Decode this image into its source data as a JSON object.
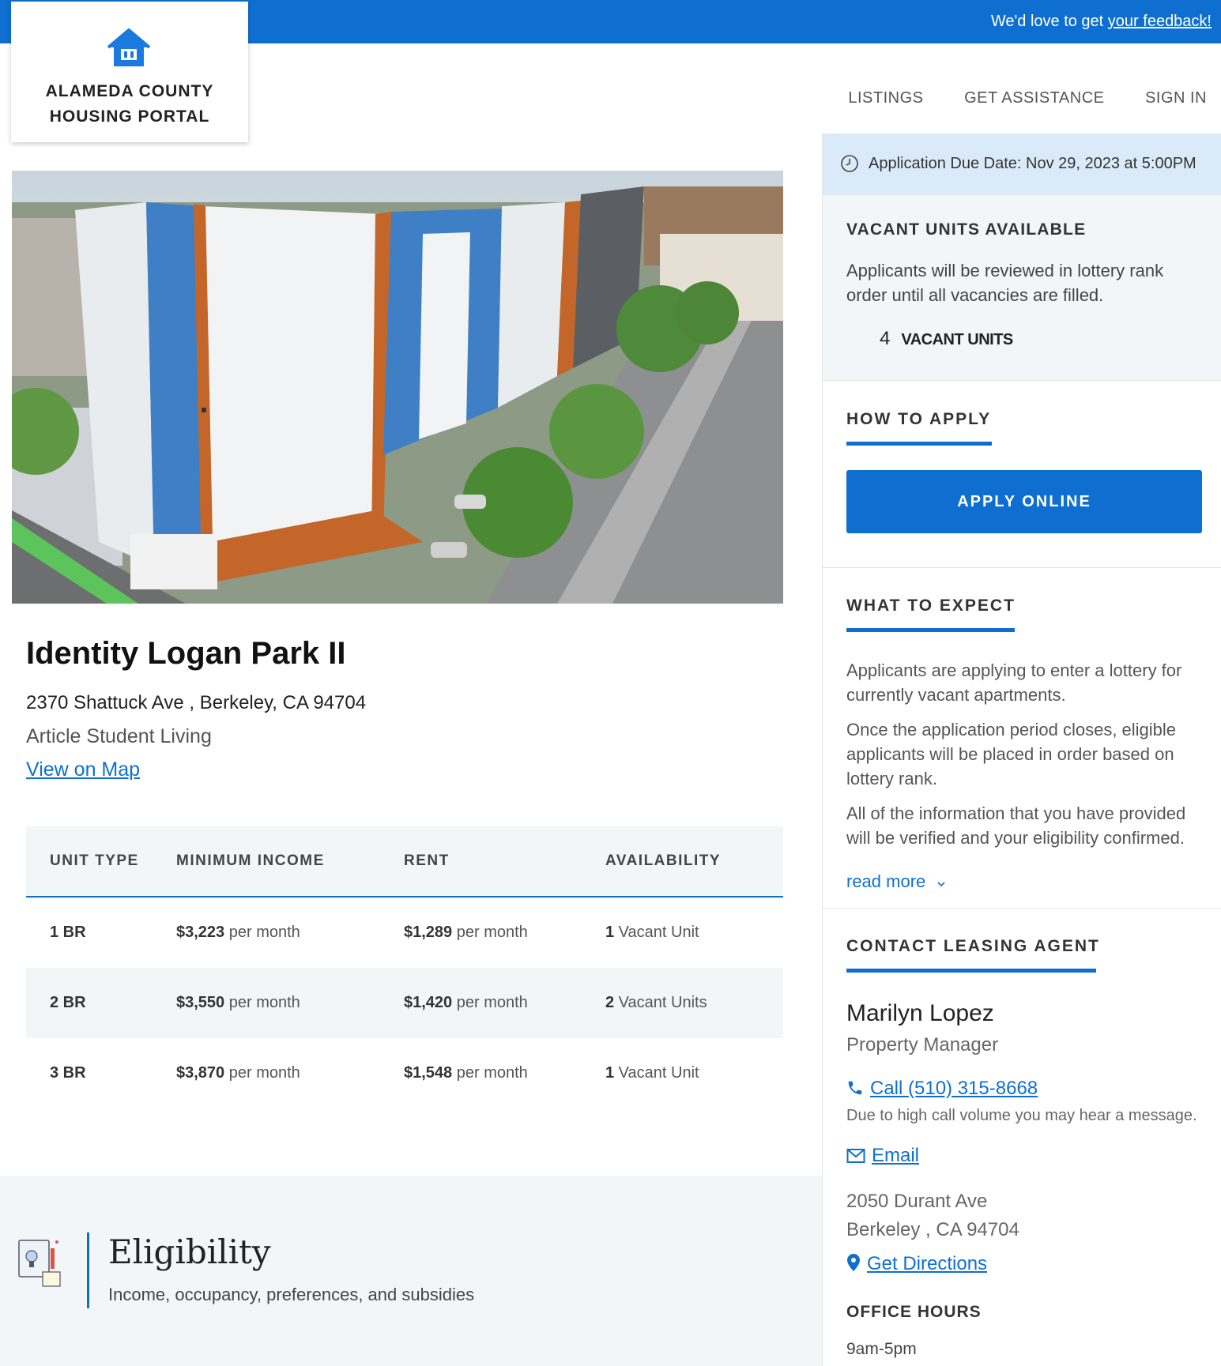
{
  "banner": {
    "feedback_prefix": "We'd love to get ",
    "feedback_link": "your feedback!"
  },
  "logo": {
    "line1": "ALAMEDA COUNTY",
    "line2": "HOUSING PORTAL",
    "icon": "house-icon"
  },
  "nav": {
    "items": [
      "LISTINGS",
      "GET ASSISTANCE",
      "SIGN IN"
    ]
  },
  "listing": {
    "photo_alt": "aerial photo of apartment building",
    "name": "Identity Logan Park II",
    "address": "2370 Shattuck Ave , Berkeley, CA 94704",
    "developer": "Article Student Living",
    "map_link": "View on Map"
  },
  "units_table": {
    "headers": [
      "UNIT TYPE",
      "MINIMUM INCOME",
      "RENT",
      "AVAILABILITY"
    ],
    "rows": [
      {
        "type": "1 BR",
        "income": "$3,223",
        "income_unit": " per month",
        "rent": "$1,289",
        "rent_unit": " per month",
        "count": "1",
        "avail": " Vacant Unit"
      },
      {
        "type": "2 BR",
        "income": "$3,550",
        "income_unit": " per month",
        "rent": "$1,420",
        "rent_unit": " per month",
        "count": "2",
        "avail": " Vacant Units"
      },
      {
        "type": "3 BR",
        "income": "$3,870",
        "income_unit": " per month",
        "rent": "$1,548",
        "rent_unit": " per month",
        "count": "1",
        "avail": " Vacant Unit"
      }
    ]
  },
  "eligibility": {
    "title": "Eligibility",
    "subtitle": "Income, occupancy, preferences, and subsidies"
  },
  "sidebar": {
    "due_date": "Application Due Date: Nov 29, 2023 at 5:00PM",
    "vacant": {
      "heading": "VACANT UNITS AVAILABLE",
      "text": "Applicants will be reviewed in lottery rank order until all vacancies are filled.",
      "count": "4",
      "label": "VACANT UNITS"
    },
    "how_to_apply": {
      "heading": "HOW TO APPLY",
      "button": "APPLY ONLINE"
    },
    "what_to_expect": {
      "heading": "WHAT TO EXPECT",
      "paragraphs": [
        "Applicants are applying to enter a lottery for currently vacant apartments.",
        "Once the application period closes, eligible applicants will be placed in order based on lottery rank.",
        "All of the information that you have provided will be verified and your eligibility confirmed."
      ],
      "read_more": "read more"
    },
    "contact": {
      "heading": "CONTACT LEASING AGENT",
      "name": "Marilyn Lopez",
      "title": "Property Manager",
      "call": "Call (510) 315-8668",
      "call_note": "Due to high call volume you may hear a message.",
      "email": "Email",
      "address_line1": "2050 Durant Ave",
      "address_line2": "Berkeley , CA 94704",
      "directions": "Get Directions",
      "office_hours_heading": "OFFICE HOURS",
      "office_hours": "9am-5pm"
    }
  },
  "colors": {
    "primary": "#0e6fd1",
    "due_bg": "#dbeaf8",
    "panel_bg": "#f3f6f8"
  }
}
